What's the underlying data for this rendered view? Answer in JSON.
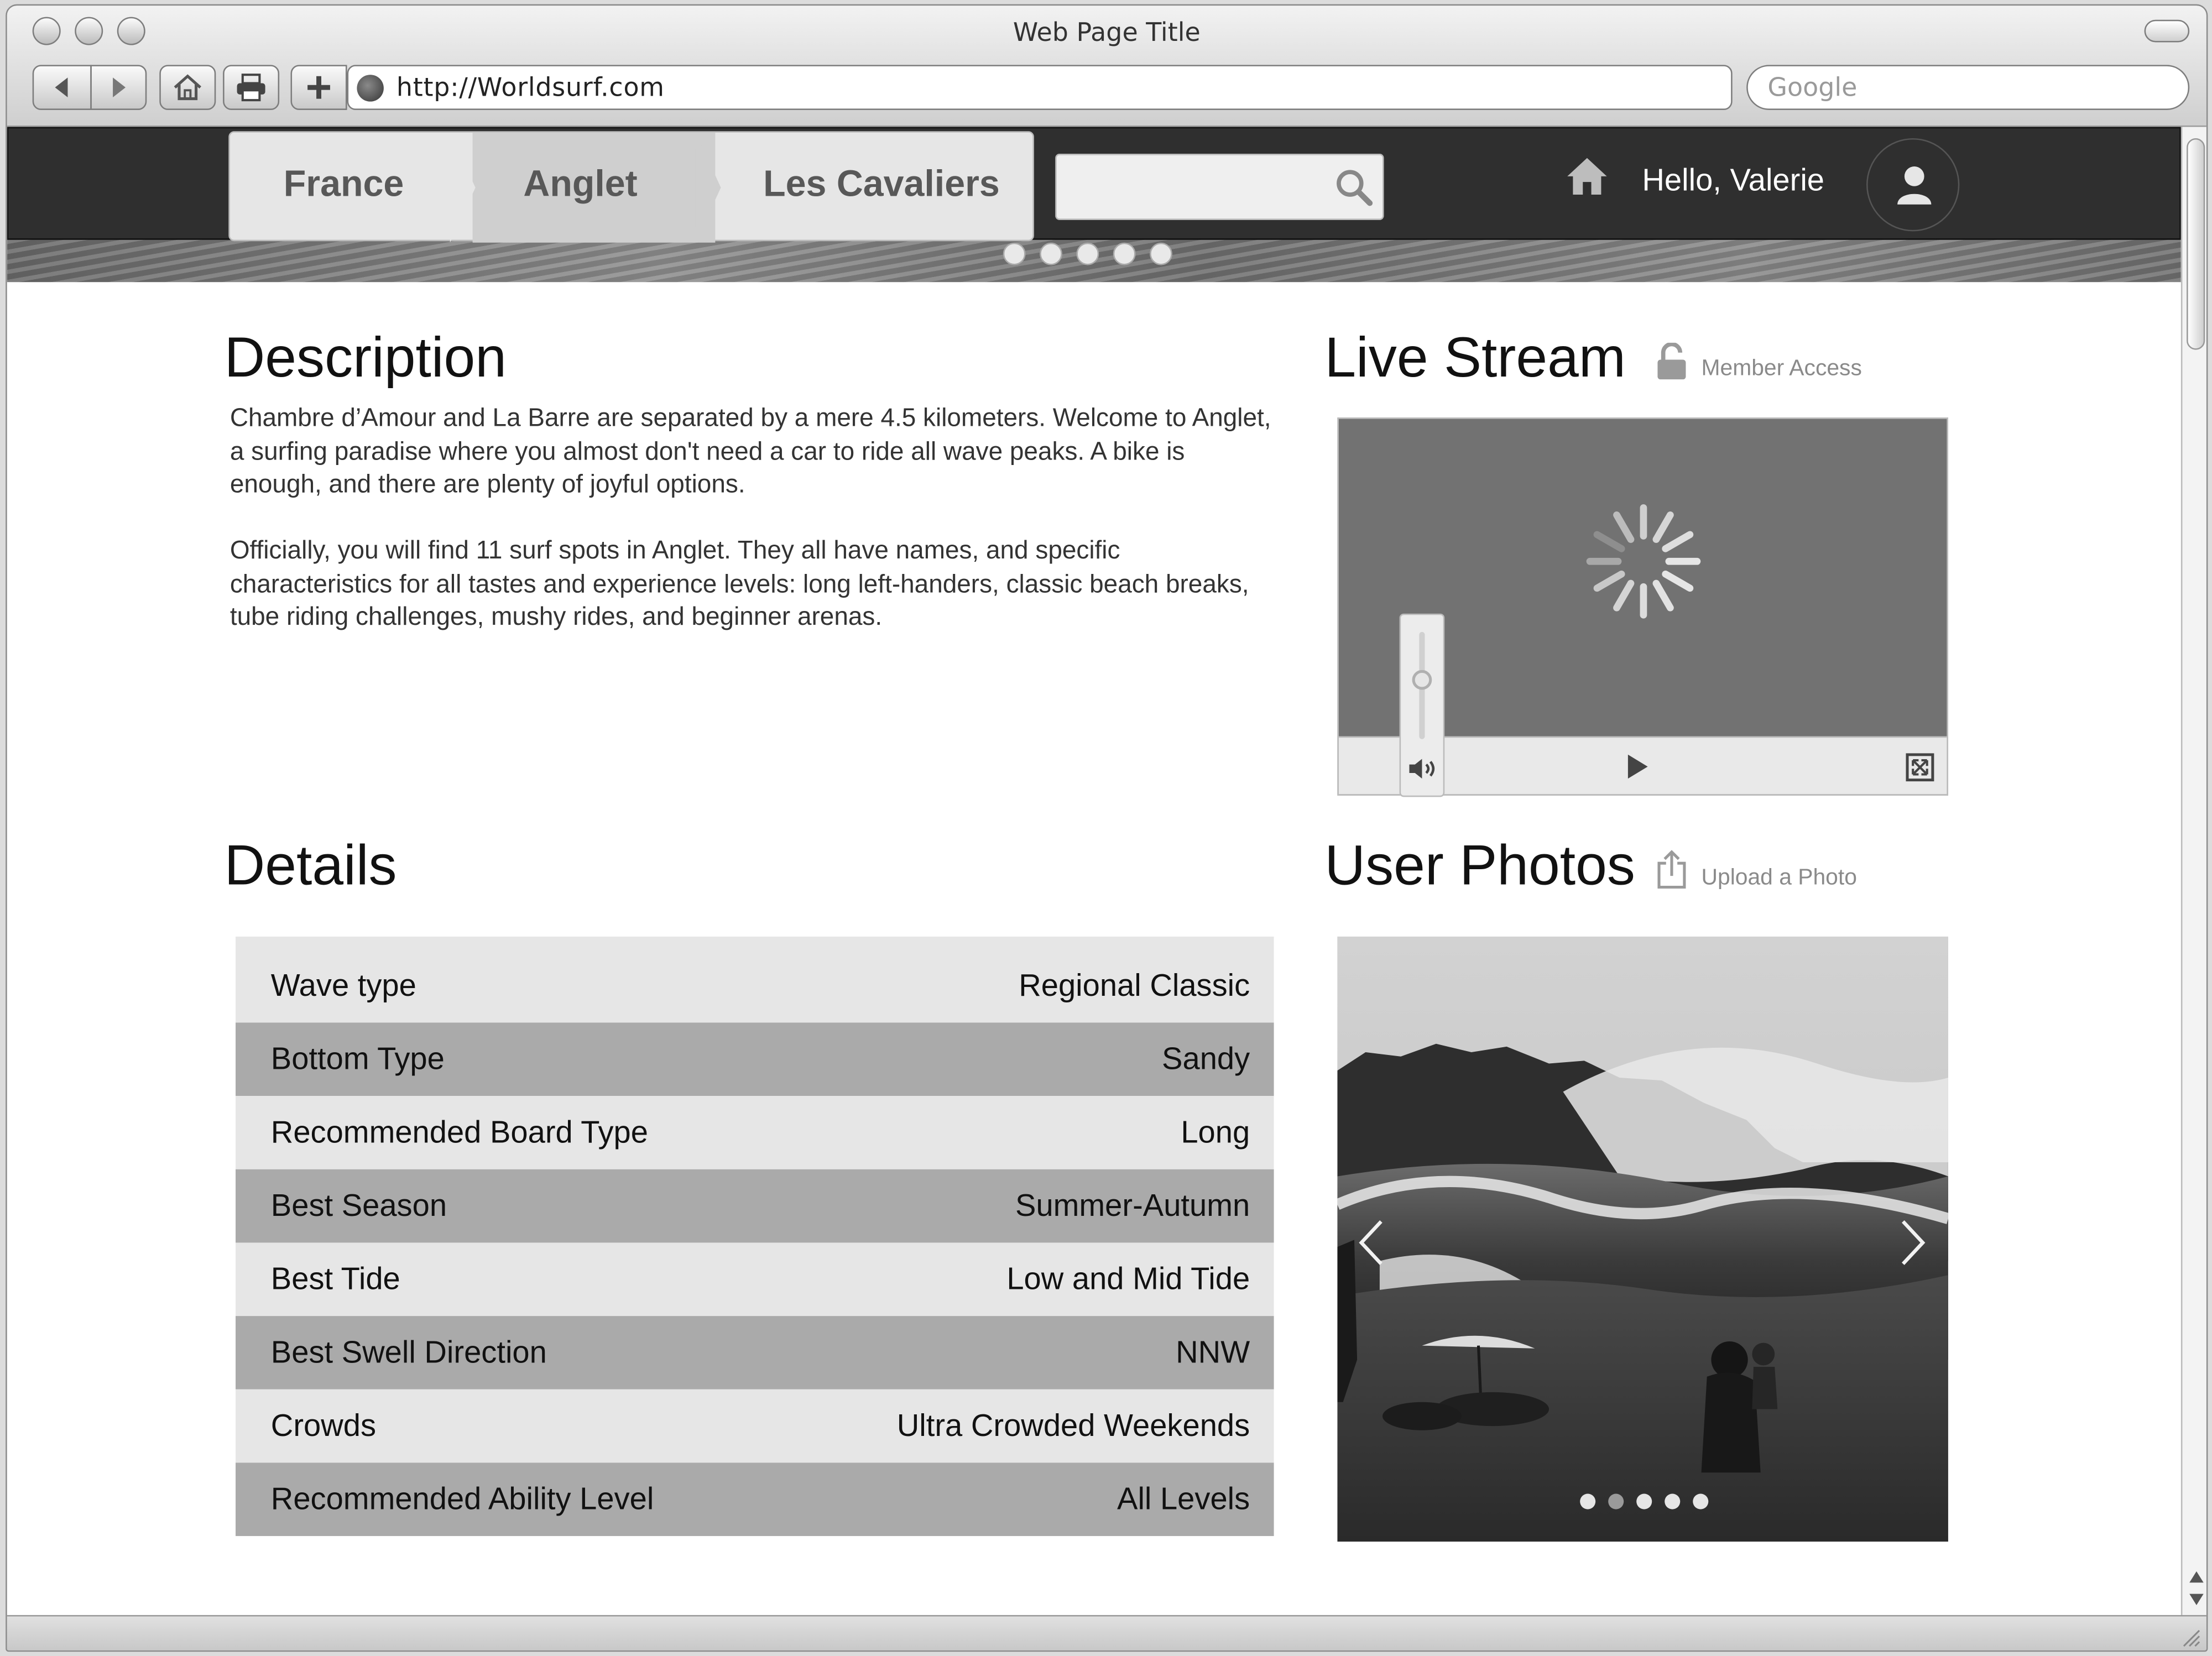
{
  "browser": {
    "window_title": "Web Page Title",
    "url": "http://Worldsurf.com",
    "search_placeholder": "Google"
  },
  "header": {
    "breadcrumb": [
      "France",
      "Anglet",
      "Les Cavaliers"
    ],
    "search_value": "",
    "greeting": "Hello, Valerie",
    "carousel_dots": 5
  },
  "description": {
    "heading": "Description",
    "paragraphs": [
      "Chambre d’Amour and La Barre are separated by a mere 4.5 kilometers. Welcome to Anglet, a surfing paradise where you almost don't need a car to ride all wave peaks. A bike is enough, and there are plenty of joyful options.",
      "Officially, you will find 11 surf spots in Anglet. They all have names, and specific characteristics for all tastes and experience levels: long left-handers, classic beach breaks, tube riding challenges, mushy rides, and beginner arenas."
    ]
  },
  "live_stream": {
    "heading": "Live Stream",
    "access_label": "Member Access",
    "volume_level": 0.55
  },
  "details": {
    "heading": "Details",
    "rows": [
      {
        "label": "Wave type",
        "value": "Regional Classic"
      },
      {
        "label": "Bottom Type",
        "value": "Sandy"
      },
      {
        "label": "Recommended Board Type",
        "value": "Long"
      },
      {
        "label": "Best Season",
        "value": "Summer-Autumn"
      },
      {
        "label": "Best Tide",
        "value": "Low and Mid Tide"
      },
      {
        "label": "Best Swell Direction",
        "value": "NNW"
      },
      {
        "label": "Crowds",
        "value": "Ultra Crowded Weekends"
      },
      {
        "label": "Recommended Ability Level",
        "value": "All Levels"
      }
    ]
  },
  "user_photos": {
    "heading": "User Photos",
    "upload_label": "Upload a Photo",
    "dots": 5,
    "active_dot": 2
  },
  "colors": {
    "topbar": "#2f2f2f",
    "row_light": "#e6e6e6",
    "row_dark": "#aaaaaa"
  }
}
